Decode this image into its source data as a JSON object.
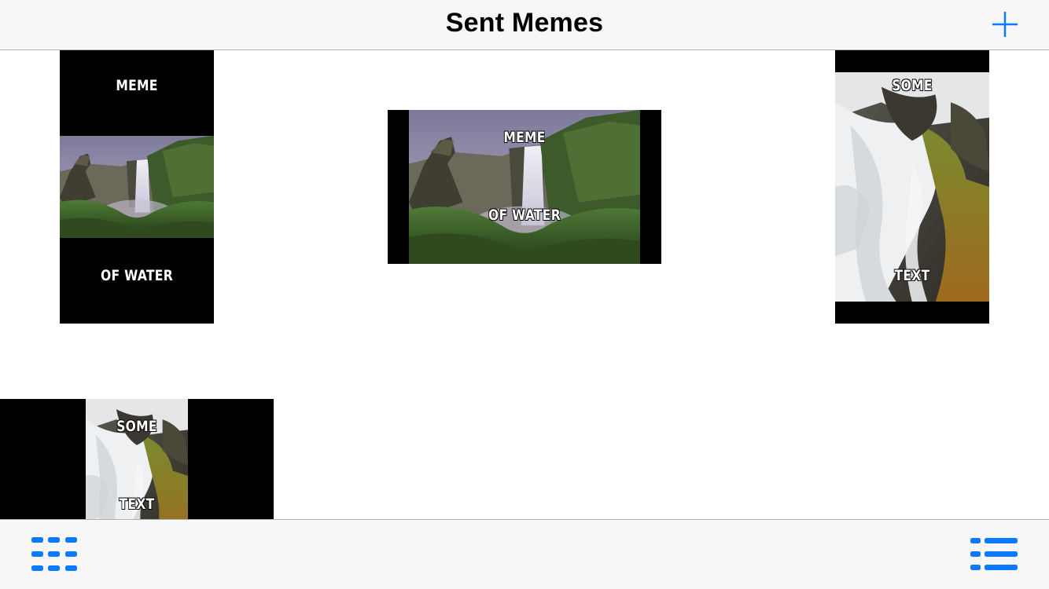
{
  "navbar": {
    "title": "Sent Memes",
    "add_icon": "plus-icon"
  },
  "memes": [
    {
      "top_text": "MEME",
      "bottom_text": "OF WATER",
      "image": "waterfall-landscape"
    },
    {
      "top_text": "MEME",
      "bottom_text": "OF WATER",
      "image": "waterfall-landscape"
    },
    {
      "top_text": "SOME",
      "bottom_text": "TEXT",
      "image": "cascade-closeup"
    },
    {
      "top_text": "SOME",
      "bottom_text": "TEXT",
      "image": "cascade-closeup"
    }
  ],
  "toolbar": {
    "grid_icon": "grid-view-icon",
    "list_icon": "list-view-icon"
  },
  "colors": {
    "accent": "#0a7aff",
    "bar_background": "#f7f7f7",
    "cell_background": "#000000"
  }
}
